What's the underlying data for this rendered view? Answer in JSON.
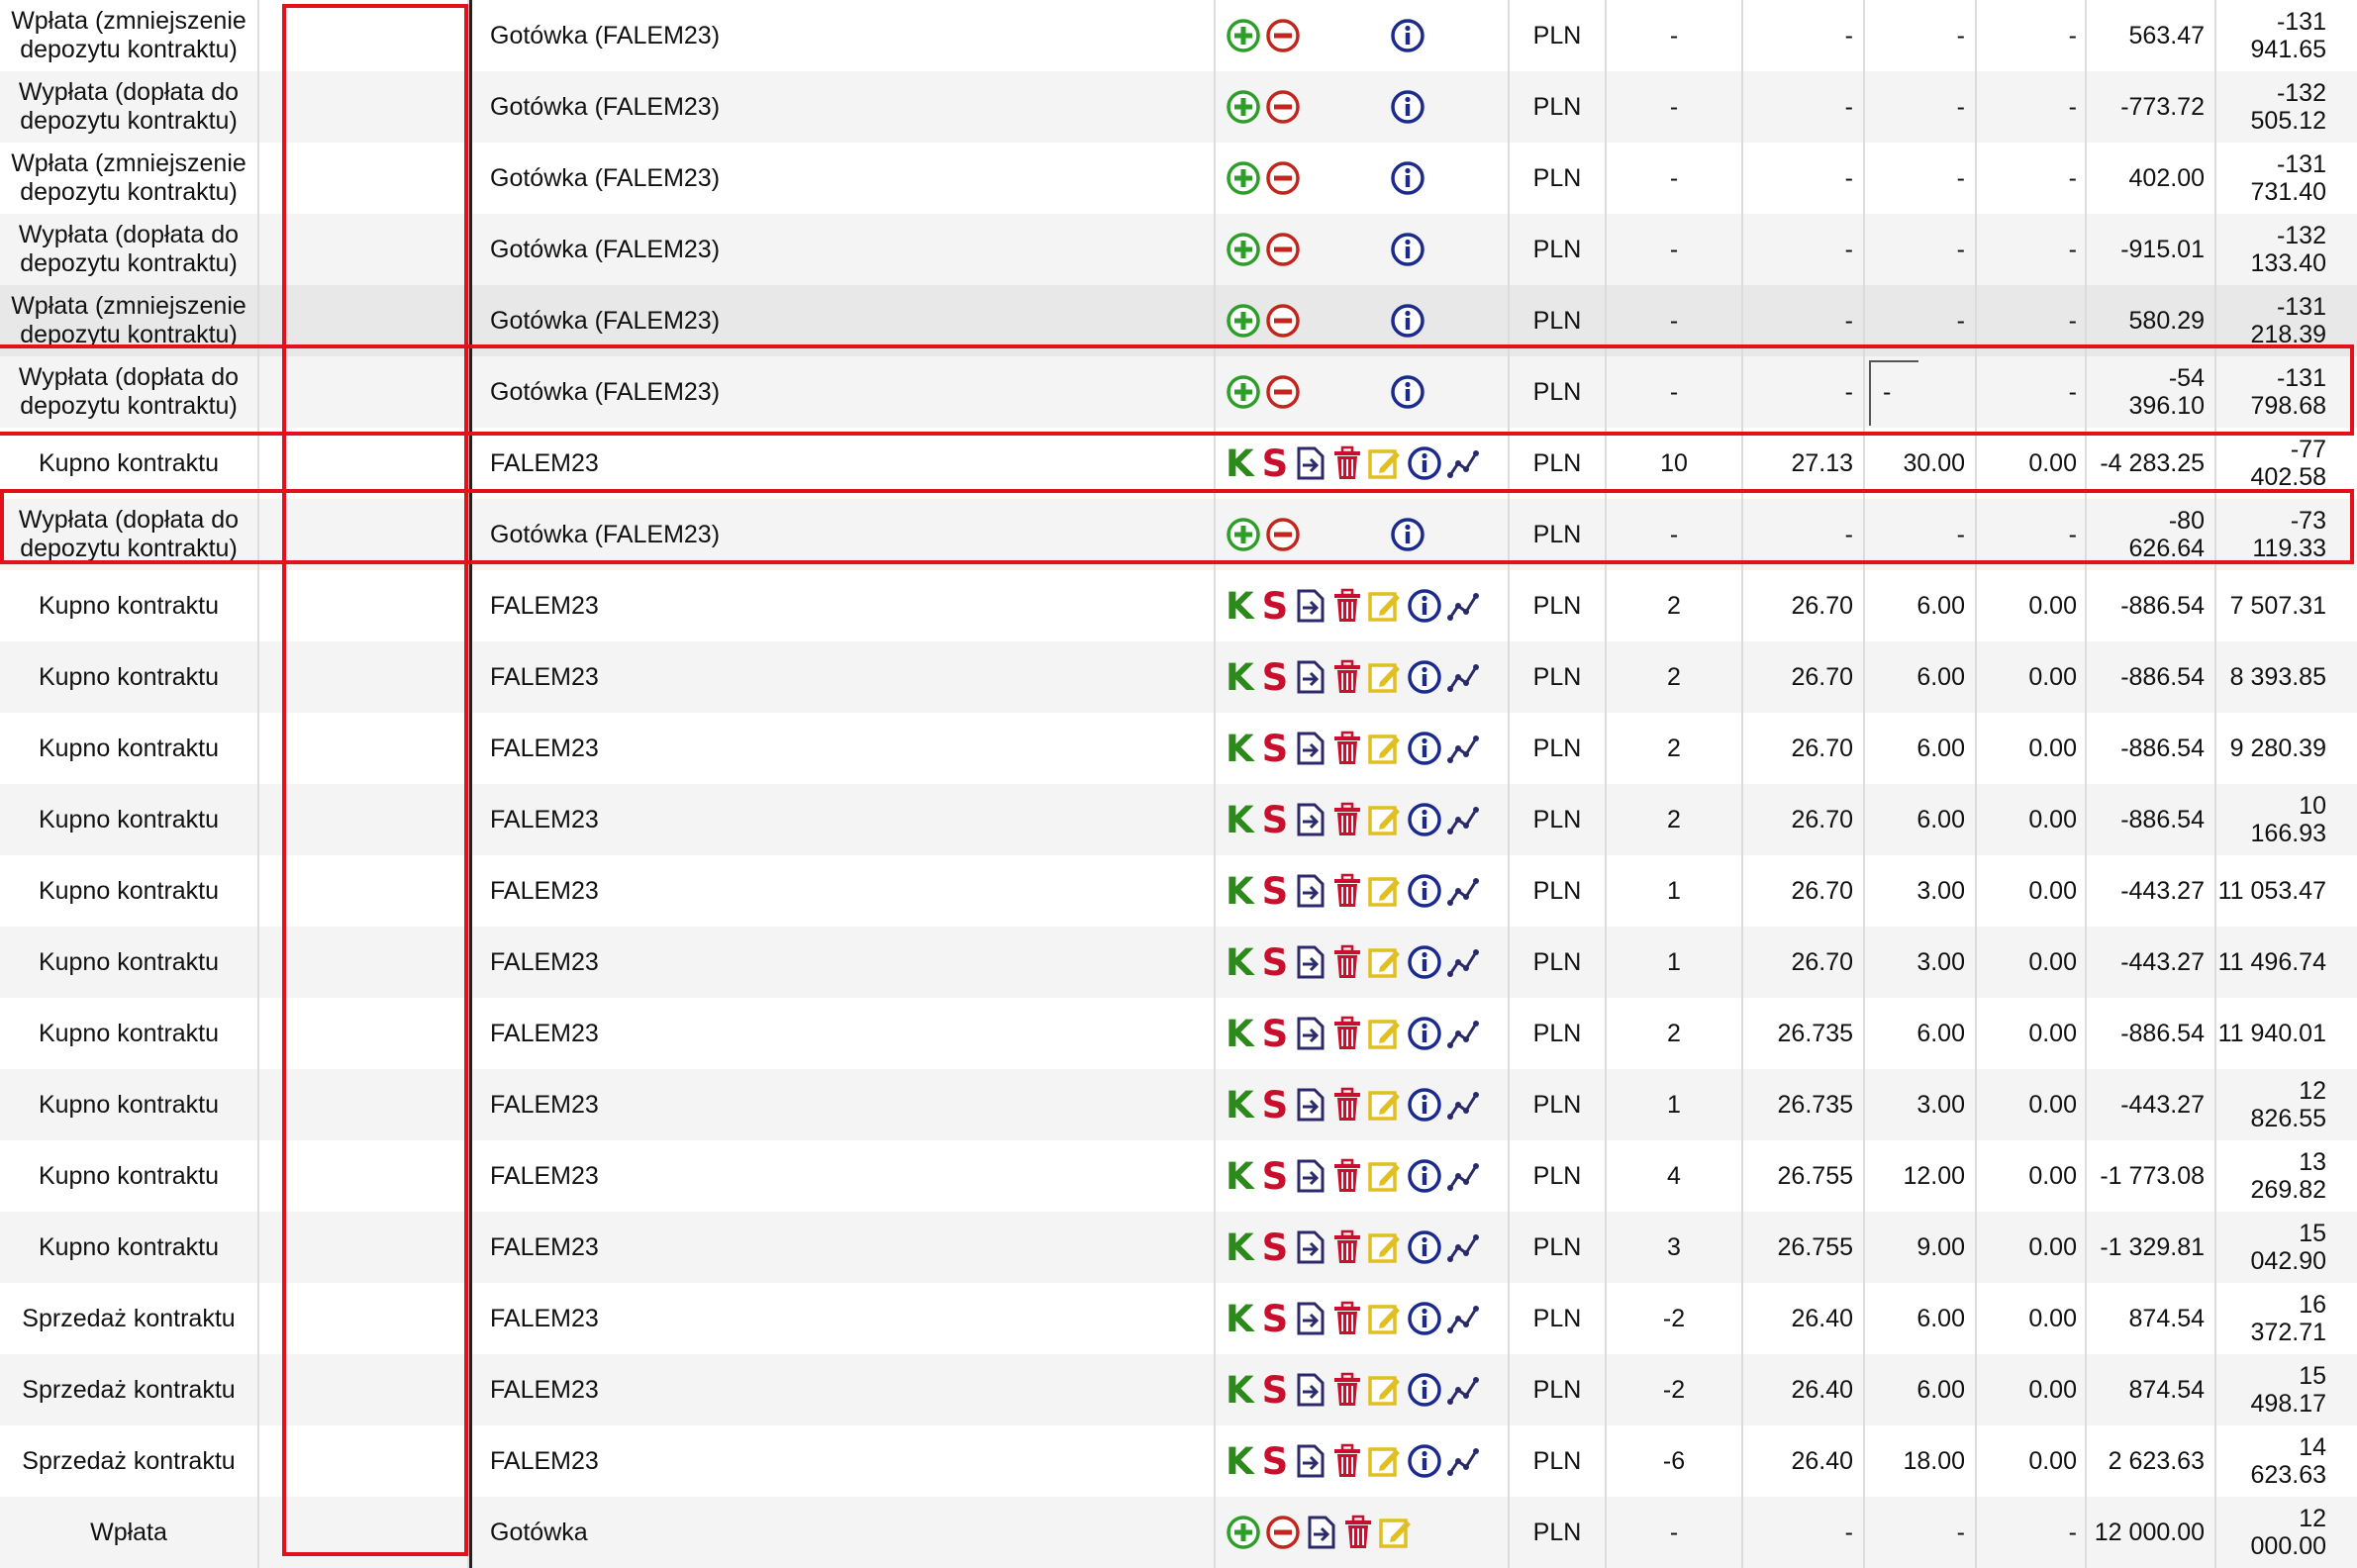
{
  "currency": "PLN",
  "colors": {
    "highlight": "#e2111a",
    "k_green": "#2b8a1a",
    "s_red": "#c8102e",
    "info_blue": "#1b2a8f",
    "edit_yellow": "#e0c020",
    "plus_green": "#2e9e2a",
    "minus_red": "#c0261c"
  },
  "icons": {
    "cash_ops": [
      "plus-circle-icon",
      "minus-circle-icon",
      "info-icon"
    ],
    "trade_ops": [
      "k-letter-icon",
      "s-letter-icon",
      "export-icon",
      "trash-icon",
      "edit-icon",
      "info-icon",
      "chart-icon"
    ],
    "deposit_ops": [
      "plus-circle-icon",
      "minus-circle-icon",
      "export-icon",
      "trash-icon",
      "edit-icon"
    ]
  },
  "rows": [
    {
      "type": "Wpłata (zmniejszenie depozytu kontraktu)",
      "name": "Gotówka (FALEM23)",
      "ops": "cash",
      "cur": "PLN",
      "qty": "-",
      "price": "-",
      "value": "-",
      "fee": "-",
      "amount": "563.47",
      "balance": "-131 941.65"
    },
    {
      "type": "Wypłata (dopłata do depozytu kontraktu)",
      "name": "Gotówka (FALEM23)",
      "ops": "cash",
      "cur": "PLN",
      "qty": "-",
      "price": "-",
      "value": "-",
      "fee": "-",
      "amount": "-773.72",
      "balance": "-132 505.12"
    },
    {
      "type": "Wpłata (zmniejszenie depozytu kontraktu)",
      "name": "Gotówka (FALEM23)",
      "ops": "cash",
      "cur": "PLN",
      "qty": "-",
      "price": "-",
      "value": "-",
      "fee": "-",
      "amount": "402.00",
      "balance": "-131 731.40"
    },
    {
      "type": "Wypłata (dopłata do depozytu kontraktu)",
      "name": "Gotówka (FALEM23)",
      "ops": "cash",
      "cur": "PLN",
      "qty": "-",
      "price": "-",
      "value": "-",
      "fee": "-",
      "amount": "-915.01",
      "balance": "-132 133.40"
    },
    {
      "type": "Wpłata (zmniejszenie depozytu kontraktu)",
      "name": "Gotówka (FALEM23)",
      "ops": "cash",
      "cur": "PLN",
      "qty": "-",
      "price": "-",
      "value": "-",
      "fee": "-",
      "amount": "580.29",
      "balance": "-131 218.39"
    },
    {
      "type": "Wypłata (dopłata do depozytu kontraktu)",
      "name": "Gotówka (FALEM23)",
      "ops": "cash",
      "cur": "PLN",
      "qty": "-",
      "price": "-",
      "value": "-",
      "fee": "-",
      "amount": "-54 396.10",
      "balance": "-131 798.68"
    },
    {
      "type": "Kupno kontraktu",
      "name": "FALEM23",
      "ops": "trade",
      "cur": "PLN",
      "qty": "10",
      "price": "27.13",
      "value": "30.00",
      "fee": "0.00",
      "amount": "-4 283.25",
      "balance": "-77 402.58"
    },
    {
      "type": "Wypłata (dopłata do depozytu kontraktu)",
      "name": "Gotówka (FALEM23)",
      "ops": "cash",
      "cur": "PLN",
      "qty": "-",
      "price": "-",
      "value": "-",
      "fee": "-",
      "amount": "-80 626.64",
      "balance": "-73 119.33"
    },
    {
      "type": "Kupno kontraktu",
      "name": "FALEM23",
      "ops": "trade",
      "cur": "PLN",
      "qty": "2",
      "price": "26.70",
      "value": "6.00",
      "fee": "0.00",
      "amount": "-886.54",
      "balance": "7 507.31"
    },
    {
      "type": "Kupno kontraktu",
      "name": "FALEM23",
      "ops": "trade",
      "cur": "PLN",
      "qty": "2",
      "price": "26.70",
      "value": "6.00",
      "fee": "0.00",
      "amount": "-886.54",
      "balance": "8 393.85"
    },
    {
      "type": "Kupno kontraktu",
      "name": "FALEM23",
      "ops": "trade",
      "cur": "PLN",
      "qty": "2",
      "price": "26.70",
      "value": "6.00",
      "fee": "0.00",
      "amount": "-886.54",
      "balance": "9 280.39"
    },
    {
      "type": "Kupno kontraktu",
      "name": "FALEM23",
      "ops": "trade",
      "cur": "PLN",
      "qty": "2",
      "price": "26.70",
      "value": "6.00",
      "fee": "0.00",
      "amount": "-886.54",
      "balance": "10 166.93"
    },
    {
      "type": "Kupno kontraktu",
      "name": "FALEM23",
      "ops": "trade",
      "cur": "PLN",
      "qty": "1",
      "price": "26.70",
      "value": "3.00",
      "fee": "0.00",
      "amount": "-443.27",
      "balance": "11 053.47"
    },
    {
      "type": "Kupno kontraktu",
      "name": "FALEM23",
      "ops": "trade",
      "cur": "PLN",
      "qty": "1",
      "price": "26.70",
      "value": "3.00",
      "fee": "0.00",
      "amount": "-443.27",
      "balance": "11 496.74"
    },
    {
      "type": "Kupno kontraktu",
      "name": "FALEM23",
      "ops": "trade",
      "cur": "PLN",
      "qty": "2",
      "price": "26.735",
      "value": "6.00",
      "fee": "0.00",
      "amount": "-886.54",
      "balance": "11 940.01"
    },
    {
      "type": "Kupno kontraktu",
      "name": "FALEM23",
      "ops": "trade",
      "cur": "PLN",
      "qty": "1",
      "price": "26.735",
      "value": "3.00",
      "fee": "0.00",
      "amount": "-443.27",
      "balance": "12 826.55"
    },
    {
      "type": "Kupno kontraktu",
      "name": "FALEM23",
      "ops": "trade",
      "cur": "PLN",
      "qty": "4",
      "price": "26.755",
      "value": "12.00",
      "fee": "0.00",
      "amount": "-1 773.08",
      "balance": "13 269.82"
    },
    {
      "type": "Kupno kontraktu",
      "name": "FALEM23",
      "ops": "trade",
      "cur": "PLN",
      "qty": "3",
      "price": "26.755",
      "value": "9.00",
      "fee": "0.00",
      "amount": "-1 329.81",
      "balance": "15 042.90"
    },
    {
      "type": "Sprzedaż kontraktu",
      "name": "FALEM23",
      "ops": "trade",
      "cur": "PLN",
      "qty": "-2",
      "price": "26.40",
      "value": "6.00",
      "fee": "0.00",
      "amount": "874.54",
      "balance": "16 372.71"
    },
    {
      "type": "Sprzedaż kontraktu",
      "name": "FALEM23",
      "ops": "trade",
      "cur": "PLN",
      "qty": "-2",
      "price": "26.40",
      "value": "6.00",
      "fee": "0.00",
      "amount": "874.54",
      "balance": "15 498.17"
    },
    {
      "type": "Sprzedaż kontraktu",
      "name": "FALEM23",
      "ops": "trade",
      "cur": "PLN",
      "qty": "-6",
      "price": "26.40",
      "value": "18.00",
      "fee": "0.00",
      "amount": "2 623.63",
      "balance": "14 623.63"
    },
    {
      "type": "Wpłata",
      "name": "Gotówka",
      "ops": "deposit",
      "cur": "PLN",
      "qty": "-",
      "price": "-",
      "value": "-",
      "fee": "-",
      "amount": "12 000.00",
      "balance": "12 000.00"
    }
  ]
}
